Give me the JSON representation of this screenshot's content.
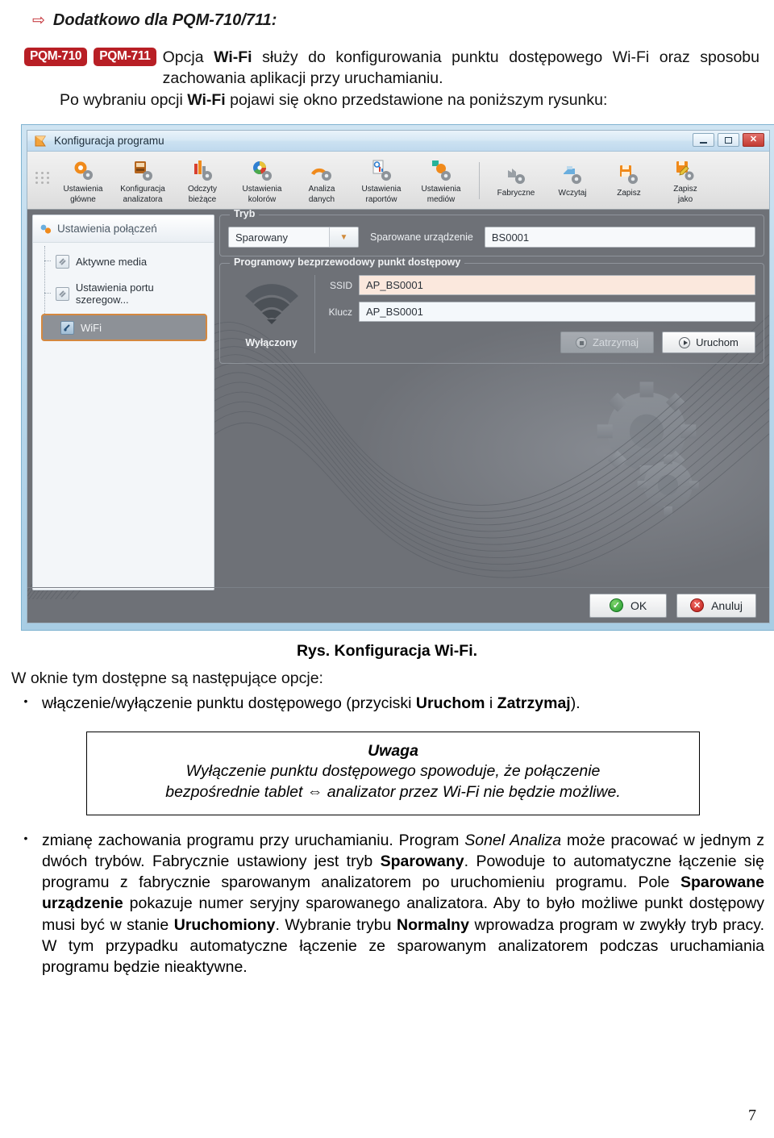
{
  "doc": {
    "header_arrow": "⇨",
    "header_title": "Dodatkowo dla PQM-710/711:",
    "badges": [
      "PQM-710",
      "PQM-711"
    ],
    "intro_part1": "Opcja ",
    "intro_bold1": "Wi-Fi",
    "intro_part2": " służy do konfigurowania punktu dostępowego Wi-Fi oraz sposobu zachowania aplikacji przy uruchamianiu.",
    "intro2_part1": "Po wybraniu opcji ",
    "intro2_bold": "Wi-Fi",
    "intro2_part2": " pojawi się okno przedstawione na poniższym rysunku:",
    "figure_caption": "Rys. Konfiguracja Wi-Fi.",
    "options_lead": "W oknie tym dostępne są następujące opcje:",
    "bullet1_pre": "włączenie/wyłączenie punktu dostępowego (przyciski ",
    "bullet1_b1": "Uruchom",
    "bullet1_mid": " i ",
    "bullet1_b2": "Zatrzymaj",
    "bullet1_post": ").",
    "note_title": "Uwaga",
    "note_line1": "Wyłączenie punktu dostępowego spowoduje, że połączenie",
    "note_line2_a": "bezpośrednie tablet ",
    "note_arrow": "⇔",
    "note_line2_b": " analizator przez Wi-Fi nie będzie możliwe.",
    "bullet2_a": "zmianę zachowania programu przy uruchamianiu. Program ",
    "bullet2_i1": "Sonel Analiza",
    "bullet2_b": " może pracować w jednym z dwóch trybów. Fabrycznie ustawiony jest tryb ",
    "bullet2_bold1": "Sparowany",
    "bullet2_c": ". Powoduje to automatyczne łączenie się programu z fabrycznie sparowanym analizatorem po uruchomieniu programu. Pole ",
    "bullet2_bold2": "Sparowane urządzenie",
    "bullet2_d": " pokazuje numer seryjny sparowanego analizatora. Aby to było możliwe punkt dostępowy musi być w stanie ",
    "bullet2_bold3": "Uruchomiony",
    "bullet2_e": ". Wybranie trybu ",
    "bullet2_bold4": "Normalny",
    "bullet2_f": " wprowadza program w zwykły tryb pracy. W tym przypadku automatyczne łączenie ze sparowanym analizatorem podczas uruchamiania programu będzie nieaktywne.",
    "bullet_marker": "•",
    "page_number": "7"
  },
  "app": {
    "title": "Konfiguracja programu",
    "logo_icon": "app-flag-icon",
    "window_controls": [
      {
        "name": "minimize",
        "glyph": "—"
      },
      {
        "name": "maximize",
        "glyph": "❐"
      },
      {
        "name": "close",
        "glyph": "✕"
      }
    ],
    "toolbar": {
      "grip_icon": "drag-grip-icon",
      "items": [
        {
          "label_line1": "Ustawienia",
          "label_line2": "główne",
          "icon": "gear-orange-icon"
        },
        {
          "label_line1": "Konfiguracja",
          "label_line2": "analizatora",
          "icon": "analyzer-gear-icon"
        },
        {
          "label_line1": "Odczyty",
          "label_line2": "bieżące",
          "icon": "bars-gear-icon"
        },
        {
          "label_line1": "Ustawienia",
          "label_line2": "kolorów",
          "icon": "color-wheel-gear-icon"
        },
        {
          "label_line1": "Analiza",
          "label_line2": "danych",
          "icon": "analysis-arc-gear-icon"
        },
        {
          "label_line1": "Ustawienia",
          "label_line2": "raportów",
          "icon": "report-gear-icon"
        },
        {
          "label_line1": "Ustawienia",
          "label_line2": "mediów",
          "icon": "media-gear-icon"
        }
      ],
      "items2": [
        {
          "label_line1": "Fabryczne",
          "label_line2": "",
          "icon": "factory-gear-icon"
        },
        {
          "label_line1": "Wczytaj",
          "label_line2": "",
          "icon": "load-gear-icon"
        },
        {
          "label_line1": "Zapisz",
          "label_line2": "",
          "icon": "save-floppy-gear-icon"
        },
        {
          "label_line1": "Zapisz",
          "label_line2": "jako",
          "icon": "save-as-gear-icon"
        }
      ]
    },
    "sidebar": {
      "header": "Ustawienia połączeń",
      "header_icon": "connection-settings-icon",
      "items": [
        {
          "label": "Aktywne media",
          "icon": "media-node-icon",
          "selected": false
        },
        {
          "label": "Ustawienia portu szeregow...",
          "icon": "serial-port-icon",
          "selected": false
        },
        {
          "label": "WiFi",
          "icon": "wifi-node-icon",
          "selected": true
        }
      ]
    },
    "mode_group": {
      "title": "Tryb",
      "mode_value": "Sparowany",
      "dropdown_icon": "chevron-down-icon",
      "paired_device_label": "Sparowane urządzenie",
      "paired_device_value": "BS0001"
    },
    "ap_group": {
      "title": "Programowy bezprzewodowy punkt dostępowy",
      "wifi_icon": "wifi-signal-icon",
      "state": "Wyłączony",
      "ssid_label": "SSID",
      "ssid_value": "AP_BS0001",
      "key_label": "Klucz",
      "key_value": "AP_BS0001",
      "stop_button": "Zatrzymaj",
      "stop_icon": "stop-circle-icon",
      "stop_disabled": true,
      "start_button": "Uruchom",
      "start_icon": "play-circle-icon"
    },
    "footer": {
      "ok_label": "OK",
      "ok_icon": "check-circle-icon",
      "cancel_label": "Anuluj",
      "cancel_icon": "cross-circle-icon"
    },
    "colors": {
      "accent_orange": "#d4883f",
      "badge_red": "#b81f25",
      "panel_gray": "#6e7177",
      "ssid_field": "#fbe8dd"
    }
  }
}
